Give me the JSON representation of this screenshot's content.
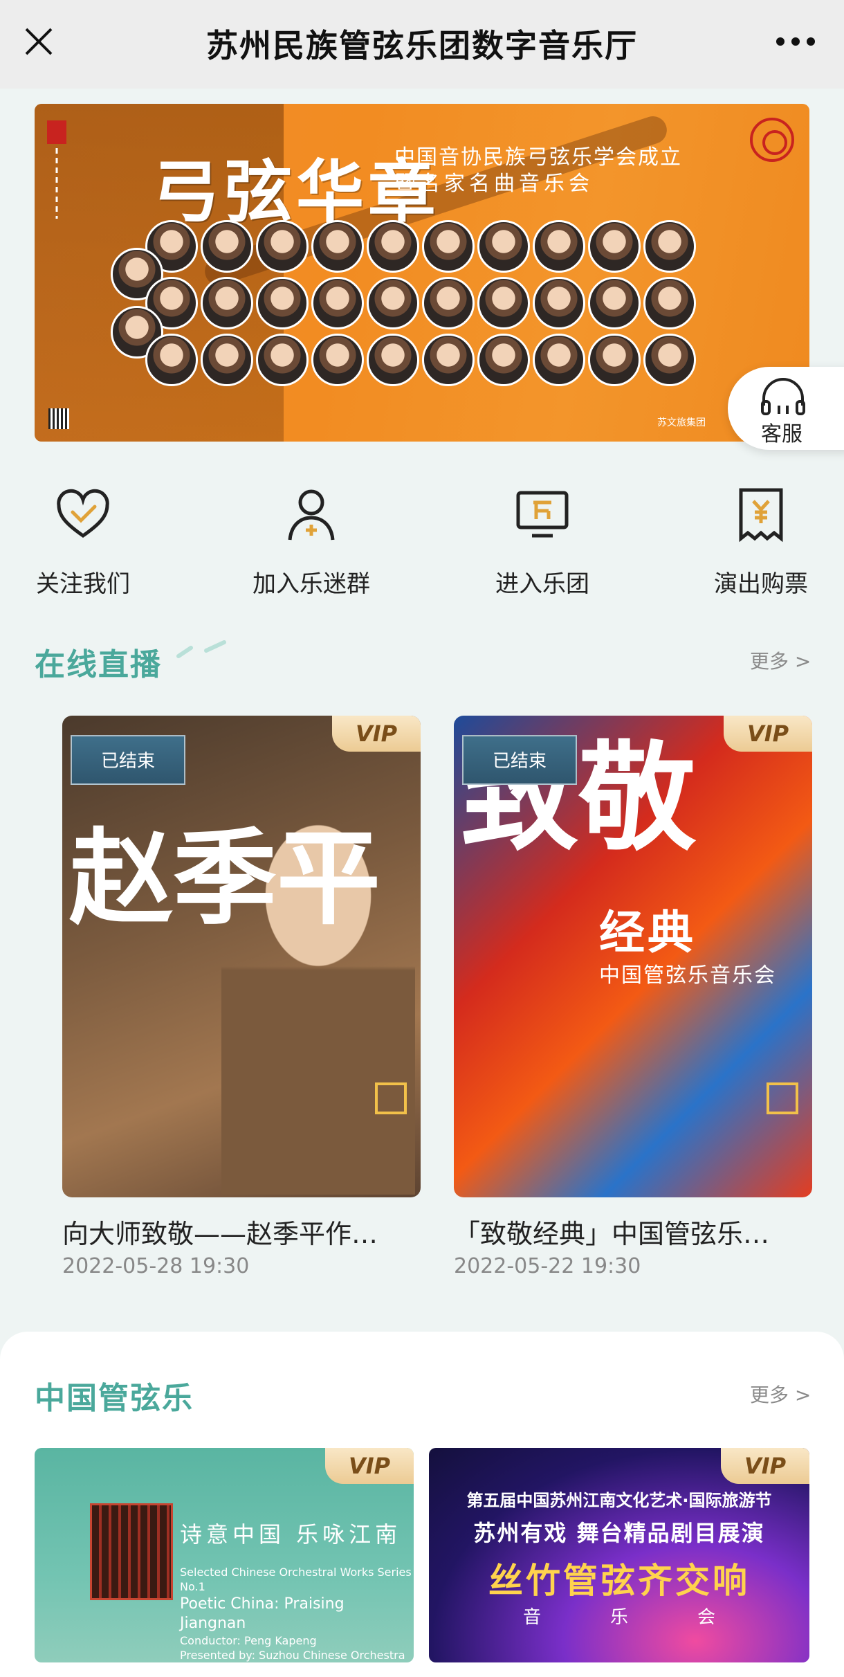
{
  "topbar": {
    "title": "苏州民族管弦乐团数字音乐厅"
  },
  "banner": {
    "headline": "弓弦华章",
    "subtitle_line1": "中国音协民族弓弦乐学会成立",
    "subtitle_line2": "暨名家名曲音乐会",
    "brand": "苏文旅集团"
  },
  "service": {
    "label": "客服"
  },
  "quick_nav": [
    {
      "label": "关注我们",
      "icon": "heart-check-icon"
    },
    {
      "label": "加入乐迷群",
      "icon": "add-user-icon"
    },
    {
      "label": "进入乐团",
      "icon": "orchestra-screen-icon"
    },
    {
      "label": "演出购票",
      "icon": "ticket-icon"
    }
  ],
  "live": {
    "title": "在线直播",
    "more": "更多 >",
    "cards": [
      {
        "status": "已结束",
        "badge": "VIP",
        "poster_calligraphy": "赵季平",
        "title": "向大师致敬——赵季平作…",
        "date": "2022-05-28 19:30"
      },
      {
        "status": "已结束",
        "badge": "VIP",
        "poster_calligraphy": "致敬",
        "poster_title": "经典",
        "poster_subtitle": "中国管弦乐音乐会",
        "title": "「致敬经典」中国管弦乐…",
        "date": "2022-05-22 19:30"
      }
    ]
  },
  "orchestral": {
    "title": "中国管弦乐",
    "more": "更多 >",
    "cards": [
      {
        "badge": "VIP",
        "poster_title": "诗意中国 乐咏江南",
        "poster_en_sub": "Selected Chinese Orchestral Works Series No.1",
        "poster_en_title": "Poetic China: Praising Jiangnan",
        "poster_en_cond": "Conductor: Peng Kapeng",
        "poster_en_pres": "Presented by: Suzhou Chinese Orchestra"
      },
      {
        "badge": "VIP",
        "poster_l1": "第五届中国苏州江南文化艺术·国际旅游节",
        "poster_l2": "苏州有戏 舞台精品剧目展演",
        "poster_l3": "丝竹管弦齐交响",
        "poster_l4": "音乐会"
      }
    ]
  },
  "colors": {
    "accent": "#4aa89b",
    "vip_gold": "#eccb94",
    "banner_orange": "#f28c22"
  }
}
